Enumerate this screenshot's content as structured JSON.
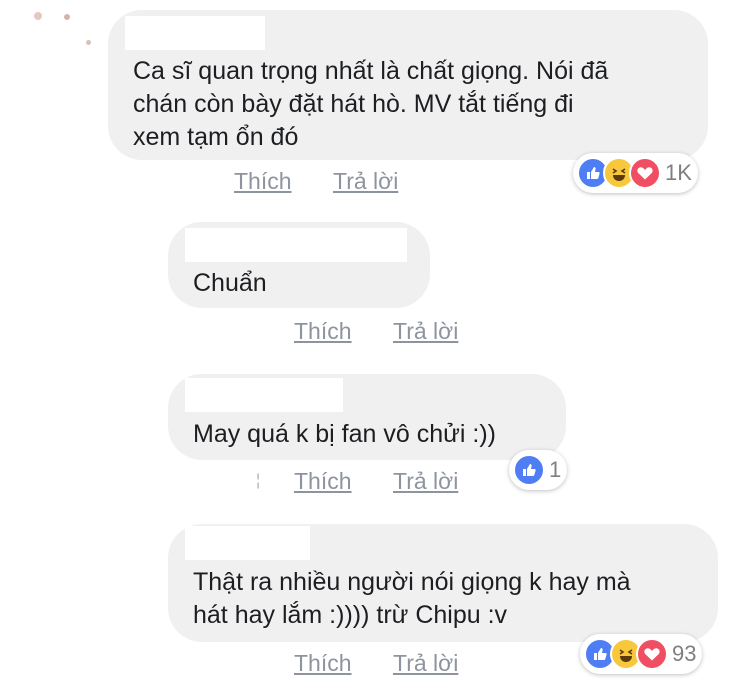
{
  "comments": [
    {
      "text_lines": [
        "Ca sĩ quan trọng nhất là chất giọng. Nói đã",
        "chán còn bày đặt hát hò. MV tắt tiếng đi",
        "xem tạm ổn đó"
      ],
      "like_label": "Thích",
      "reply_label": "Trả lời",
      "reaction_count": "1K",
      "reactions": [
        "like-icon",
        "haha-icon",
        "love-icon"
      ]
    },
    {
      "text_lines": [
        "Chuẩn"
      ],
      "like_label": "Thích",
      "reply_label": "Trả lời"
    },
    {
      "text_lines": [
        "May quá k bị fan vô chửi :))"
      ],
      "like_label": "Thích",
      "reply_label": "Trả lời",
      "reaction_count": "1",
      "reactions": [
        "like-icon"
      ]
    },
    {
      "text_lines": [
        "Thật ra nhiều người nói giọng k hay mà",
        "hát hay lắm :)))) trừ Chipu :v"
      ],
      "like_label": "Thích",
      "reply_label": "Trả lời",
      "reaction_count": "93",
      "reactions": [
        "like-icon",
        "haha-icon",
        "love-icon"
      ]
    }
  ],
  "colors": {
    "bubble": "#f1f0f0",
    "link": "#8d949e",
    "like": "#4f7df3",
    "haha": "#f7c83c",
    "love": "#f04e62"
  }
}
